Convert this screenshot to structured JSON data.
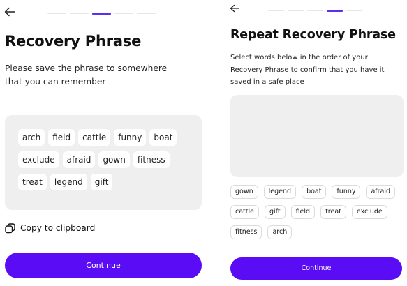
{
  "accent_color": "#5a0cf5",
  "save_screen": {
    "back_icon": "arrow-left-icon",
    "progress": {
      "total_steps": 5,
      "current_step": 3
    },
    "title": "Recovery Phrase",
    "description": "Please save the phrase to somewhere that you can remember",
    "words": [
      "arch",
      "field",
      "cattle",
      "funny",
      "boat",
      "exclude",
      "afraid",
      "gown",
      "fitness",
      "treat",
      "legend",
      "gift"
    ],
    "copy_icon": "copy-icon",
    "copy_label": "Copy to clipboard",
    "continue_label": "Continue"
  },
  "repeat_screen": {
    "back_icon": "arrow-left-icon",
    "progress": {
      "total_steps": 5,
      "current_step": 4
    },
    "title": "Repeat Recovery Phrase",
    "description": "Select words below in the order of your Recovery Phrase to confirm that you have it saved in a safe place",
    "selected_words": [],
    "word_options": [
      "gown",
      "legend",
      "boat",
      "funny",
      "afraid",
      "cattle",
      "gift",
      "field",
      "treat",
      "exclude",
      "fitness",
      "arch"
    ],
    "continue_label": "Continue"
  }
}
